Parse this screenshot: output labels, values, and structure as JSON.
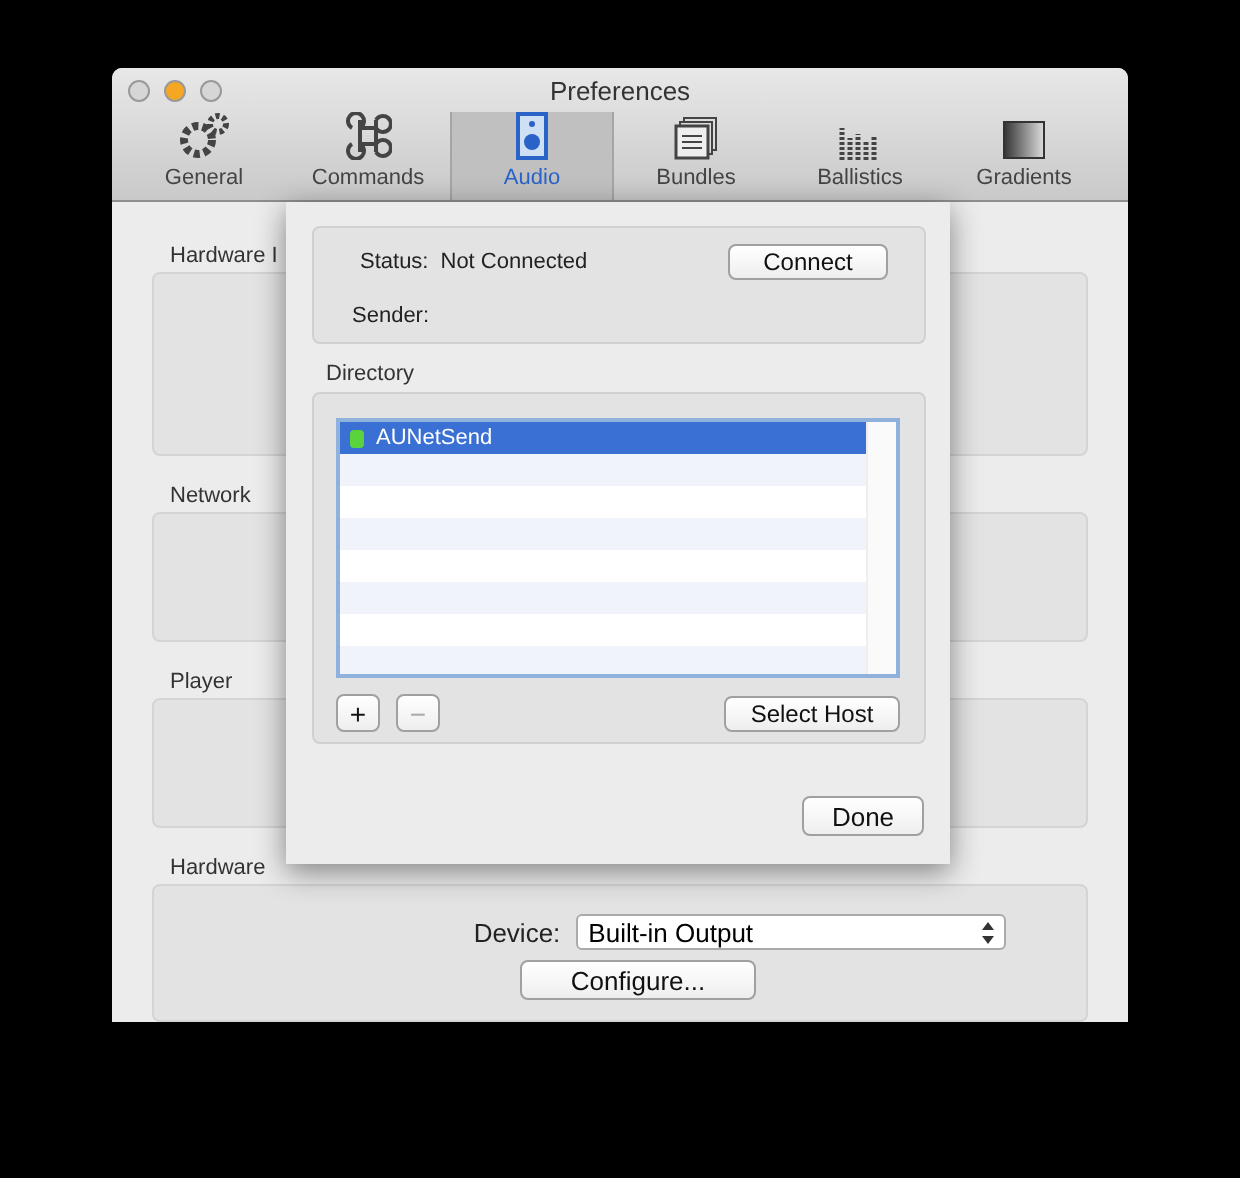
{
  "window": {
    "title": "Preferences"
  },
  "toolbar": [
    {
      "label": "General",
      "selected": false
    },
    {
      "label": "Commands",
      "selected": false
    },
    {
      "label": "Audio",
      "selected": true
    },
    {
      "label": "Bundles",
      "selected": false
    },
    {
      "label": "Ballistics",
      "selected": false
    },
    {
      "label": "Gradients",
      "selected": false
    }
  ],
  "sections": [
    {
      "label": "Hardware I"
    },
    {
      "label": "Network"
    },
    {
      "label": "Player"
    },
    {
      "label": "Hardware",
      "device_label": "Device:",
      "device": "Built-in Output",
      "configure": "Configure..."
    }
  ],
  "sheet": {
    "status_label": "Status:",
    "status": "Not Connected",
    "connect": "Connect",
    "sender_label": "Sender:",
    "directory_label": "Directory",
    "items": [
      {
        "name": "AUNetSend",
        "selected": true
      }
    ],
    "add": "+",
    "remove": "−",
    "remove_disabled": true,
    "select_host": "Select Host",
    "done": "Done"
  }
}
